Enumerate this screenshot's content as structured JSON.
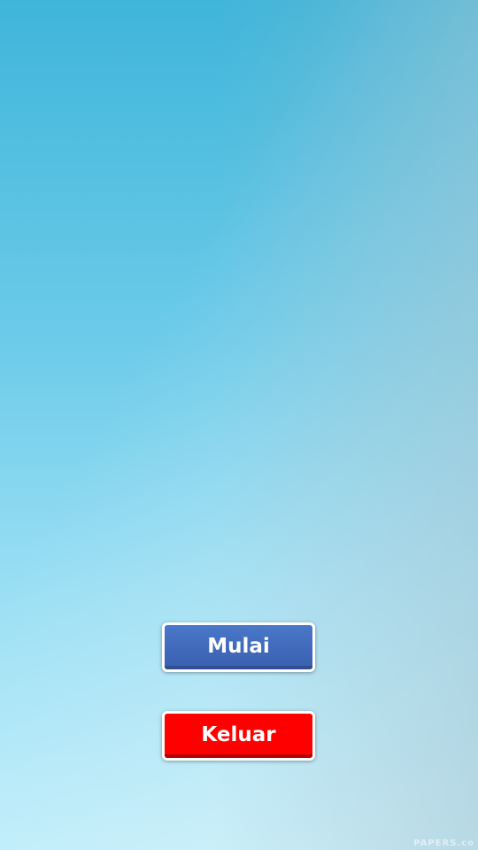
{
  "menu": {
    "start_label": "Mulai",
    "exit_label": "Keluar"
  },
  "watermark": {
    "text": "PAPERS.co"
  },
  "colors": {
    "start_button": "#4169bb",
    "exit_button": "#ff0000",
    "button_border": "#ffffff",
    "background_top": "#3fb5da",
    "background_bottom": "#bdeefb"
  }
}
